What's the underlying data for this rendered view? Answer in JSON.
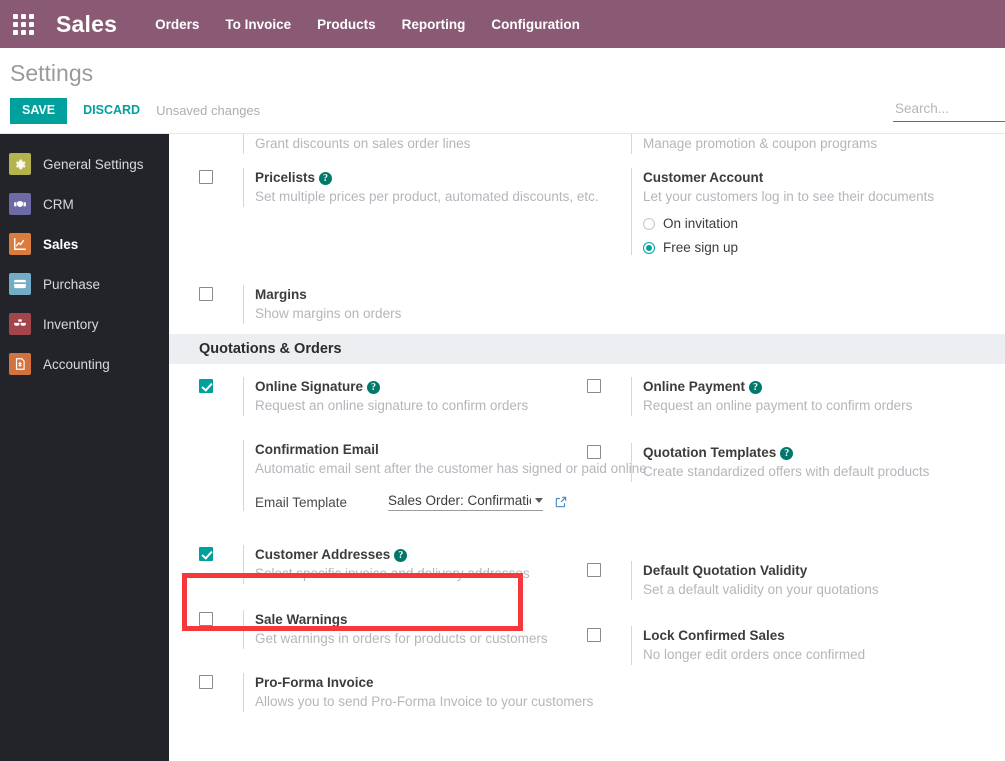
{
  "navbar": {
    "apps_icon": "apps-grid-icon",
    "brand": "Sales",
    "menu": [
      "Orders",
      "To Invoice",
      "Products",
      "Reporting",
      "Configuration"
    ]
  },
  "control_panel": {
    "title": "Settings",
    "save_label": "SAVE",
    "discard_label": "DISCARD",
    "status": "Unsaved changes",
    "search_placeholder": "Search..."
  },
  "sidebar": {
    "items": [
      {
        "label": "General Settings",
        "icon": "gear-icon",
        "color": "#b4b34d",
        "active": false
      },
      {
        "label": "CRM",
        "icon": "handshake-icon",
        "color": "#6d6aa8",
        "active": false
      },
      {
        "label": "Sales",
        "icon": "chart-line-icon",
        "color": "#db7c3f",
        "active": true
      },
      {
        "label": "Purchase",
        "icon": "credit-card-icon",
        "color": "#73acc6",
        "active": false
      },
      {
        "label": "Inventory",
        "icon": "boxes-icon",
        "color": "#a2464b",
        "active": false
      },
      {
        "label": "Accounting",
        "icon": "invoice-icon",
        "color": "#d3713f",
        "active": false
      }
    ]
  },
  "settings": {
    "top_partial": {
      "left_desc": "Grant discounts on sales order lines",
      "right_desc": "Manage promotion & coupon programs"
    },
    "pricing_left": [
      {
        "title": "Pricelists",
        "desc": "Set multiple prices per product, automated discounts, etc.",
        "checked": false,
        "help": true
      },
      {
        "title": "Margins",
        "desc": "Show margins on orders",
        "checked": false,
        "help": false
      }
    ],
    "customer_account": {
      "title": "Customer Account",
      "desc": "Let your customers log in to see their documents",
      "options": [
        {
          "label": "On invitation",
          "selected": false
        },
        {
          "label": "Free sign up",
          "selected": true
        }
      ]
    },
    "section_quotations": "Quotations & Orders",
    "quotations_left": [
      {
        "title": "Online Signature",
        "desc": "Request an online signature to confirm orders",
        "checked": true,
        "help": true
      },
      {
        "title": "Confirmation Email",
        "desc": "Automatic email sent after the customer has signed or paid online",
        "checked": false,
        "no_checkbox": true,
        "help": false,
        "subfield": {
          "label": "Email Template",
          "value": "Sales Order: Confirmatic",
          "internal_link_icon": "external-link-icon"
        }
      },
      {
        "title": "Customer Addresses",
        "desc": "Select specific invoice and delivery addresses",
        "checked": true,
        "help": true,
        "highlighted": true
      },
      {
        "title": "Sale Warnings",
        "desc": "Get warnings in orders for products or customers",
        "checked": false,
        "help": false
      },
      {
        "title": "Pro-Forma Invoice",
        "desc": "Allows you to send Pro-Forma Invoice to your customers",
        "checked": false,
        "help": false
      }
    ],
    "quotations_right": [
      {
        "title": "Online Payment",
        "desc": "Request an online payment to confirm orders",
        "checked": false,
        "help": true
      },
      {
        "title": "Quotation Templates",
        "desc": "Create standardized offers with default products",
        "checked": false,
        "help": true
      },
      {
        "title": "Default Quotation Validity",
        "desc": "Set a default validity on your quotations",
        "checked": false,
        "help": false
      },
      {
        "title": "Lock Confirmed Sales",
        "desc": "No longer edit orders once confirmed",
        "checked": false,
        "help": false
      }
    ]
  },
  "colors": {
    "navbar": "#8a5a74",
    "accent": "#00a09d",
    "highlight": "#f4383c",
    "sidebar_bg": "#23242a",
    "section_band": "#eceef1"
  }
}
